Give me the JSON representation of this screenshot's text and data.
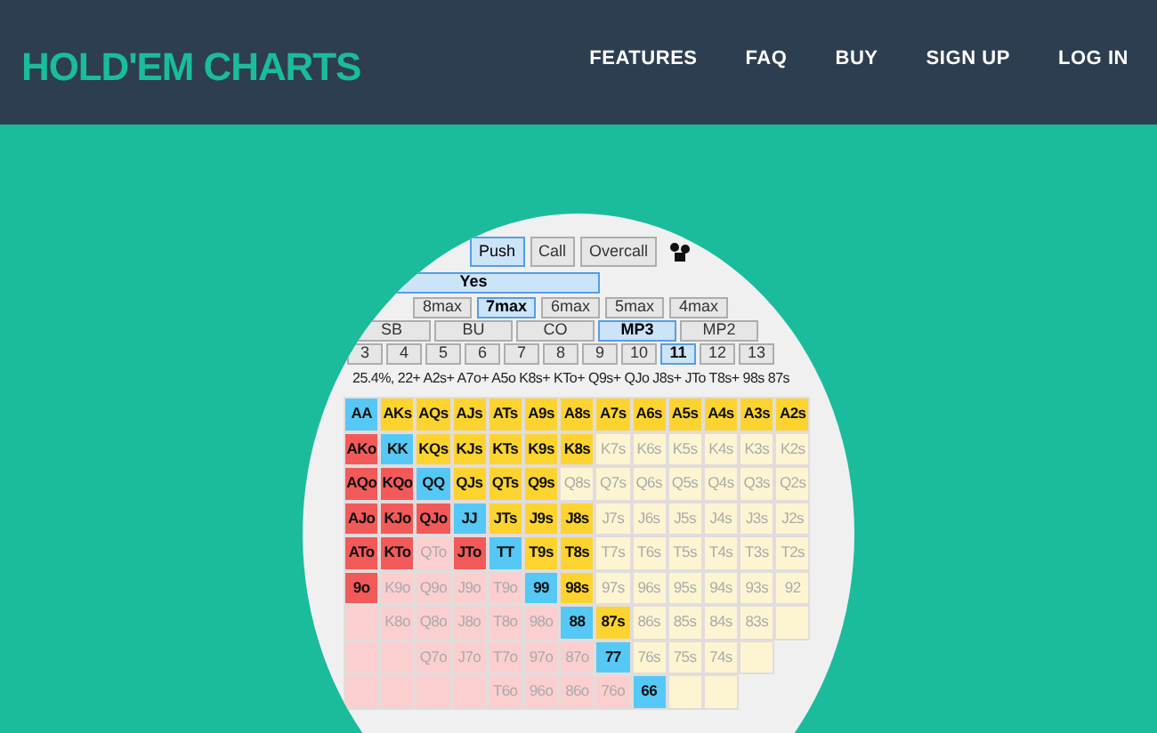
{
  "header": {
    "logo": "HOLD'EM CHARTS",
    "nav": [
      "FEATURES",
      "FAQ",
      "BUY",
      "SIGN UP",
      "LOG IN"
    ]
  },
  "app": {
    "actions": [
      {
        "label": "Push",
        "selected": true
      },
      {
        "label": "Call",
        "selected": false
      },
      {
        "label": "Overcall",
        "selected": false
      }
    ],
    "answer": {
      "label": "Yes",
      "selected": true
    },
    "table_sizes": [
      {
        "label": "8max",
        "selected": false
      },
      {
        "label": "7max",
        "selected": true
      },
      {
        "label": "6max",
        "selected": false
      },
      {
        "label": "5max",
        "selected": false
      },
      {
        "label": "4max",
        "selected": false
      }
    ],
    "positions": [
      {
        "label": "SB",
        "selected": false
      },
      {
        "label": "BU",
        "selected": false
      },
      {
        "label": "CO",
        "selected": false
      },
      {
        "label": "MP3",
        "selected": true
      },
      {
        "label": "MP2",
        "selected": false
      }
    ],
    "stack_sizes": [
      {
        "label": "3",
        "selected": false
      },
      {
        "label": "4",
        "selected": false
      },
      {
        "label": "5",
        "selected": false
      },
      {
        "label": "6",
        "selected": false
      },
      {
        "label": "7",
        "selected": false
      },
      {
        "label": "8",
        "selected": false
      },
      {
        "label": "9",
        "selected": false
      },
      {
        "label": "10",
        "selected": false
      },
      {
        "label": "11",
        "selected": true
      },
      {
        "label": "12",
        "selected": false
      },
      {
        "label": "13",
        "selected": false
      }
    ],
    "range_text": "25.4%, 22+ A2s+ A7o+ A5o K8s+ KTo+ Q9s+ QJo J8s+ JTo T8s+ 98s 87s",
    "grid": [
      [
        {
          "label": "AA",
          "kind": "pair",
          "selected": true
        },
        {
          "label": "AKs",
          "kind": "suited",
          "selected": true
        },
        {
          "label": "AQs",
          "kind": "suited",
          "selected": true
        },
        {
          "label": "AJs",
          "kind": "suited",
          "selected": true
        },
        {
          "label": "ATs",
          "kind": "suited",
          "selected": true
        },
        {
          "label": "A9s",
          "kind": "suited",
          "selected": true
        },
        {
          "label": "A8s",
          "kind": "suited",
          "selected": true
        },
        {
          "label": "A7s",
          "kind": "suited",
          "selected": true
        },
        {
          "label": "A6s",
          "kind": "suited",
          "selected": true
        },
        {
          "label": "A5s",
          "kind": "suited",
          "selected": true
        },
        {
          "label": "A4s",
          "kind": "suited",
          "selected": true
        },
        {
          "label": "A3s",
          "kind": "suited",
          "selected": true
        },
        {
          "label": "A2s",
          "kind": "suited",
          "selected": true
        }
      ],
      [
        {
          "label": "AKo",
          "kind": "offsuit",
          "selected": true
        },
        {
          "label": "KK",
          "kind": "pair",
          "selected": true
        },
        {
          "label": "KQs",
          "kind": "suited",
          "selected": true
        },
        {
          "label": "KJs",
          "kind": "suited",
          "selected": true
        },
        {
          "label": "KTs",
          "kind": "suited",
          "selected": true
        },
        {
          "label": "K9s",
          "kind": "suited",
          "selected": true
        },
        {
          "label": "K8s",
          "kind": "suited",
          "selected": true
        },
        {
          "label": "K7s",
          "kind": "suited",
          "selected": false
        },
        {
          "label": "K6s",
          "kind": "suited",
          "selected": false
        },
        {
          "label": "K5s",
          "kind": "suited",
          "selected": false
        },
        {
          "label": "K4s",
          "kind": "suited",
          "selected": false
        },
        {
          "label": "K3s",
          "kind": "suited",
          "selected": false
        },
        {
          "label": "K2s",
          "kind": "suited",
          "selected": false
        }
      ],
      [
        {
          "label": "AQo",
          "kind": "offsuit",
          "selected": true
        },
        {
          "label": "KQo",
          "kind": "offsuit",
          "selected": true
        },
        {
          "label": "QQ",
          "kind": "pair",
          "selected": true
        },
        {
          "label": "QJs",
          "kind": "suited",
          "selected": true
        },
        {
          "label": "QTs",
          "kind": "suited",
          "selected": true
        },
        {
          "label": "Q9s",
          "kind": "suited",
          "selected": true
        },
        {
          "label": "Q8s",
          "kind": "suited",
          "selected": false
        },
        {
          "label": "Q7s",
          "kind": "suited",
          "selected": false
        },
        {
          "label": "Q6s",
          "kind": "suited",
          "selected": false
        },
        {
          "label": "Q5s",
          "kind": "suited",
          "selected": false
        },
        {
          "label": "Q4s",
          "kind": "suited",
          "selected": false
        },
        {
          "label": "Q3s",
          "kind": "suited",
          "selected": false
        },
        {
          "label": "Q2s",
          "kind": "suited",
          "selected": false
        }
      ],
      [
        {
          "label": "AJo",
          "kind": "offsuit",
          "selected": true
        },
        {
          "label": "KJo",
          "kind": "offsuit",
          "selected": true
        },
        {
          "label": "QJo",
          "kind": "offsuit",
          "selected": true
        },
        {
          "label": "JJ",
          "kind": "pair",
          "selected": true
        },
        {
          "label": "JTs",
          "kind": "suited",
          "selected": true
        },
        {
          "label": "J9s",
          "kind": "suited",
          "selected": true
        },
        {
          "label": "J8s",
          "kind": "suited",
          "selected": true
        },
        {
          "label": "J7s",
          "kind": "suited",
          "selected": false
        },
        {
          "label": "J6s",
          "kind": "suited",
          "selected": false
        },
        {
          "label": "J5s",
          "kind": "suited",
          "selected": false
        },
        {
          "label": "J4s",
          "kind": "suited",
          "selected": false
        },
        {
          "label": "J3s",
          "kind": "suited",
          "selected": false
        },
        {
          "label": "J2s",
          "kind": "suited",
          "selected": false
        }
      ],
      [
        {
          "label": "ATo",
          "kind": "offsuit",
          "selected": true
        },
        {
          "label": "KTo",
          "kind": "offsuit",
          "selected": true
        },
        {
          "label": "QTo",
          "kind": "offsuit",
          "selected": false
        },
        {
          "label": "JTo",
          "kind": "offsuit",
          "selected": true
        },
        {
          "label": "TT",
          "kind": "pair",
          "selected": true
        },
        {
          "label": "T9s",
          "kind": "suited",
          "selected": true
        },
        {
          "label": "T8s",
          "kind": "suited",
          "selected": true
        },
        {
          "label": "T7s",
          "kind": "suited",
          "selected": false
        },
        {
          "label": "T6s",
          "kind": "suited",
          "selected": false
        },
        {
          "label": "T5s",
          "kind": "suited",
          "selected": false
        },
        {
          "label": "T4s",
          "kind": "suited",
          "selected": false
        },
        {
          "label": "T3s",
          "kind": "suited",
          "selected": false
        },
        {
          "label": "T2s",
          "kind": "suited",
          "selected": false
        }
      ],
      [
        {
          "label": "9o",
          "kind": "offsuit",
          "selected": true
        },
        {
          "label": "K9o",
          "kind": "offsuit",
          "selected": false
        },
        {
          "label": "Q9o",
          "kind": "offsuit",
          "selected": false
        },
        {
          "label": "J9o",
          "kind": "offsuit",
          "selected": false
        },
        {
          "label": "T9o",
          "kind": "offsuit",
          "selected": false
        },
        {
          "label": "99",
          "kind": "pair",
          "selected": true
        },
        {
          "label": "98s",
          "kind": "suited",
          "selected": true
        },
        {
          "label": "97s",
          "kind": "suited",
          "selected": false
        },
        {
          "label": "96s",
          "kind": "suited",
          "selected": false
        },
        {
          "label": "95s",
          "kind": "suited",
          "selected": false
        },
        {
          "label": "94s",
          "kind": "suited",
          "selected": false
        },
        {
          "label": "93s",
          "kind": "suited",
          "selected": false
        },
        {
          "label": "92",
          "kind": "suited",
          "selected": false
        }
      ],
      [
        {
          "kind": "offsuit",
          "selected": false
        },
        {
          "label": "K8o",
          "kind": "offsuit",
          "selected": false
        },
        {
          "label": "Q8o",
          "kind": "offsuit",
          "selected": false
        },
        {
          "label": "J8o",
          "kind": "offsuit",
          "selected": false
        },
        {
          "label": "T8o",
          "kind": "offsuit",
          "selected": false
        },
        {
          "label": "98o",
          "kind": "offsuit",
          "selected": false
        },
        {
          "label": "88",
          "kind": "pair",
          "selected": true
        },
        {
          "label": "87s",
          "kind": "suited",
          "selected": true
        },
        {
          "label": "86s",
          "kind": "suited",
          "selected": false
        },
        {
          "label": "85s",
          "kind": "suited",
          "selected": false
        },
        {
          "label": "84s",
          "kind": "suited",
          "selected": false
        },
        {
          "label": "83s",
          "kind": "suited",
          "selected": false
        },
        {
          "kind": "suited",
          "selected": false
        }
      ],
      [
        {
          "kind": "offsuit",
          "selected": false
        },
        {
          "kind": "offsuit",
          "selected": false
        },
        {
          "label": "Q7o",
          "kind": "offsuit",
          "selected": false
        },
        {
          "label": "J7o",
          "kind": "offsuit",
          "selected": false
        },
        {
          "label": "T7o",
          "kind": "offsuit",
          "selected": false
        },
        {
          "label": "97o",
          "kind": "offsuit",
          "selected": false
        },
        {
          "label": "87o",
          "kind": "offsuit",
          "selected": false
        },
        {
          "label": "77",
          "kind": "pair",
          "selected": true
        },
        {
          "label": "76s",
          "kind": "suited",
          "selected": false
        },
        {
          "label": "75s",
          "kind": "suited",
          "selected": false
        },
        {
          "label": "74s",
          "kind": "suited",
          "selected": false
        },
        {
          "kind": "suited",
          "selected": false
        }
      ],
      [
        {
          "kind": "offsuit",
          "selected": false
        },
        {
          "kind": "offsuit",
          "selected": false
        },
        {
          "kind": "offsuit",
          "selected": false
        },
        {
          "kind": "offsuit",
          "selected": false
        },
        {
          "label": "T6o",
          "kind": "offsuit",
          "selected": false
        },
        {
          "label": "96o",
          "kind": "offsuit",
          "selected": false
        },
        {
          "label": "86o",
          "kind": "offsuit",
          "selected": false
        },
        {
          "label": "76o",
          "kind": "offsuit",
          "selected": false
        },
        {
          "label": "66",
          "kind": "pair",
          "selected": true
        },
        {
          "kind": "suited",
          "selected": false
        },
        {
          "kind": "suited",
          "selected": false
        }
      ]
    ]
  }
}
